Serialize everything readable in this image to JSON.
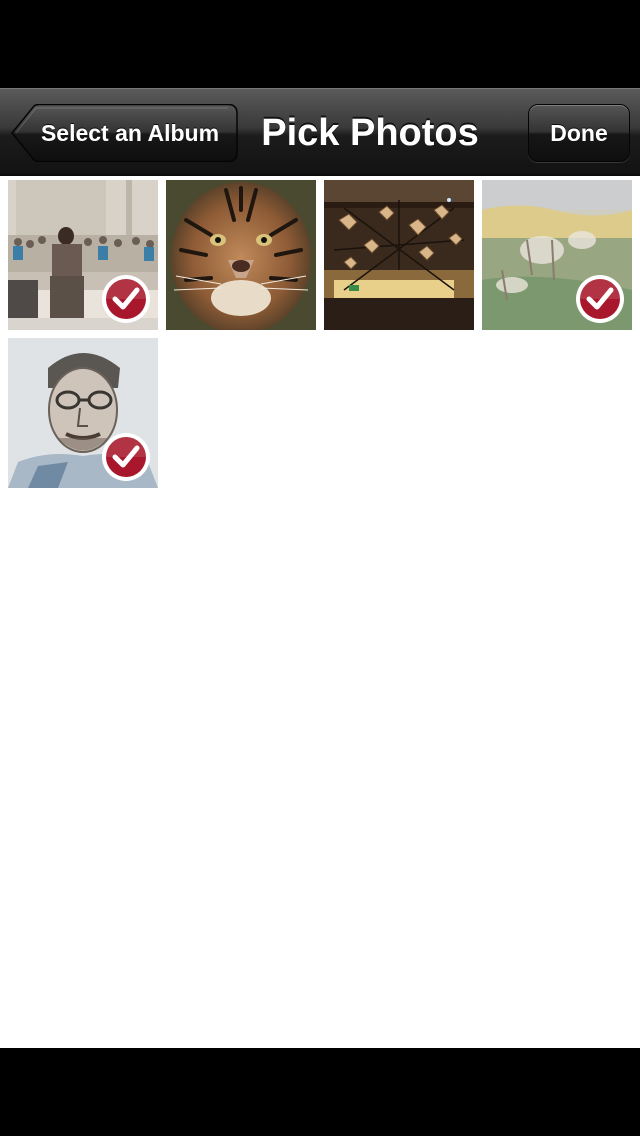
{
  "nav": {
    "title": "Pick Photos",
    "back_label": "Select an Album",
    "done_label": "Done"
  },
  "photos": [
    {
      "subject": "crowd-photo",
      "selected": true
    },
    {
      "subject": "tiger-photo",
      "selected": false
    },
    {
      "subject": "lamps-photo",
      "selected": false
    },
    {
      "subject": "painting-photo",
      "selected": true
    },
    {
      "subject": "portrait-sketch-photo",
      "selected": true
    }
  ],
  "colors": {
    "check_badge": "#a8172b",
    "nav_bar_dark": "#121212"
  }
}
